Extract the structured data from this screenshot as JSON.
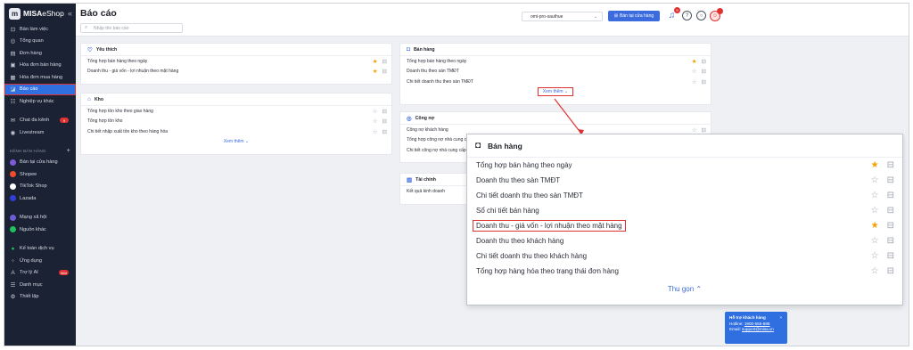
{
  "app": {
    "logo_brand": "MISA",
    "logo_product": "eShop",
    "collapse_glyph": "«"
  },
  "sidebar": {
    "items": [
      {
        "label": "Bàn làm việc",
        "icon": "desk-icon",
        "glyph": "⊡"
      },
      {
        "label": "Tổng quan",
        "icon": "dashboard-icon",
        "glyph": "◎"
      },
      {
        "label": "Đơn hàng",
        "icon": "order-icon",
        "glyph": "▤"
      },
      {
        "label": "Hóa đơn bán hàng",
        "icon": "invoice-icon",
        "glyph": "▣"
      },
      {
        "label": "Hóa đơn mua hàng",
        "icon": "purchase-invoice-icon",
        "glyph": "▦"
      },
      {
        "label": "Báo cáo",
        "icon": "report-icon",
        "glyph": "◪",
        "active": true
      },
      {
        "label": "Nghiệp vụ khác",
        "icon": "other-ops-icon",
        "glyph": "☷"
      }
    ],
    "items2": [
      {
        "label": "Chat đa kênh",
        "icon": "chat-icon",
        "glyph": "✉",
        "badge": "9"
      },
      {
        "label": "Livestream",
        "icon": "livestream-icon",
        "glyph": "◉"
      }
    ],
    "channels_caption": "KÊNH BÁN HÀNG",
    "channels_plus": "+",
    "channels": [
      {
        "label": "Bán tại cửa hàng",
        "color": "#7c5cdb"
      },
      {
        "label": "Shopee",
        "color": "#ee4d2d"
      },
      {
        "label": "TikTok Shop",
        "color": "#ffffff"
      },
      {
        "label": "Lazada",
        "color": "#2f3fd8"
      }
    ],
    "social": [
      {
        "label": "Mạng xã hội",
        "color": "#6d5bd8"
      },
      {
        "label": "Nguồn khác",
        "color": "#20c05c"
      }
    ],
    "bottom": [
      {
        "label": "Kế toán dịch vụ",
        "icon": "accounting-icon",
        "glyph": "●",
        "dotcolor": "#20c05c"
      },
      {
        "label": "Ứng dụng",
        "icon": "apps-icon",
        "glyph": "⁘"
      },
      {
        "label": "Trợ lý AI",
        "icon": "ai-icon",
        "glyph": "A",
        "badge": "Mới"
      },
      {
        "label": "Danh mục",
        "icon": "catalog-icon",
        "glyph": "☰"
      },
      {
        "label": "Thiết lập",
        "icon": "settings-icon",
        "glyph": "⚙"
      }
    ]
  },
  "header": {
    "title": "Báo cáo",
    "search_placeholder": "Nhập tên báo cáo",
    "store": "omi-pro-sauthue",
    "store_button": "Bán tại cửa hàng",
    "notif_count": "9"
  },
  "favorites": {
    "title": "Yêu thích",
    "rows": [
      {
        "label": "Tổng hợp bán hàng theo ngày",
        "starred": true
      },
      {
        "label": "Doanh thu - giá vốn - lợi nhuận theo mặt hàng",
        "starred": true
      }
    ]
  },
  "warehouse": {
    "title": "Kho",
    "rows": [
      {
        "label": "Tổng hợp tồn kho theo giao hàng",
        "starred": false
      },
      {
        "label": "Tổng hợp tồn kho",
        "starred": false
      },
      {
        "label": "Chi tiết nhập xuất tồn kho theo hàng hóa",
        "starred": false
      }
    ],
    "more": "Xem thêm"
  },
  "sales": {
    "title": "Bán hàng",
    "rows": [
      {
        "label": "Tổng hợp bán hàng theo ngày",
        "starred": true
      },
      {
        "label": "Doanh thu theo sàn TMĐT",
        "starred": false
      },
      {
        "label": "Chi tiết doanh thu theo sàn TMĐT",
        "starred": false
      }
    ],
    "more": "Xem thêm"
  },
  "debt": {
    "title": "Công nợ",
    "rows": [
      {
        "label": "Công nợ khách hàng",
        "starred": false
      },
      {
        "label": "Tổng hợp công nợ nhà cung cấp",
        "starred": false
      },
      {
        "label": "Chi tiết công nợ nhà cung cấp",
        "starred": false
      }
    ]
  },
  "finance": {
    "title": "Tài chính",
    "rows": [
      {
        "label": "Kết quả kinh doanh",
        "starred": false
      }
    ]
  },
  "popup": {
    "title": "Bán hàng",
    "rows": [
      {
        "label": "Tổng hợp bán hàng theo ngày",
        "starred": true
      },
      {
        "label": "Doanh thu theo sàn TMĐT",
        "starred": false
      },
      {
        "label": "Chi tiết doanh thu theo sàn TMĐT",
        "starred": false
      },
      {
        "label": "Sổ chi tiết bán hàng",
        "starred": false
      },
      {
        "label": "Doanh thu - giá vốn - lợi nhuận theo mặt hàng",
        "starred": true,
        "highlight": true
      },
      {
        "label": "Doanh thu theo khách hàng",
        "starred": false
      },
      {
        "label": "Chi tiết doanh thu theo khách hàng",
        "starred": false
      },
      {
        "label": "Tổng hợp hàng hóa theo trạng thái đơn hàng",
        "starred": false
      }
    ],
    "collapse": "Thu gọn"
  },
  "help": {
    "title": "Hỗ trợ khách hàng",
    "hotline_label": "Hotline:",
    "hotline": "1900-555-888",
    "email_label": "Email:",
    "email": "support@misa.vn"
  },
  "colors": {
    "accent": "#3b6bdc",
    "highlight": "#e03131",
    "star": "#f59f00",
    "sidebar": "#1b2233"
  }
}
